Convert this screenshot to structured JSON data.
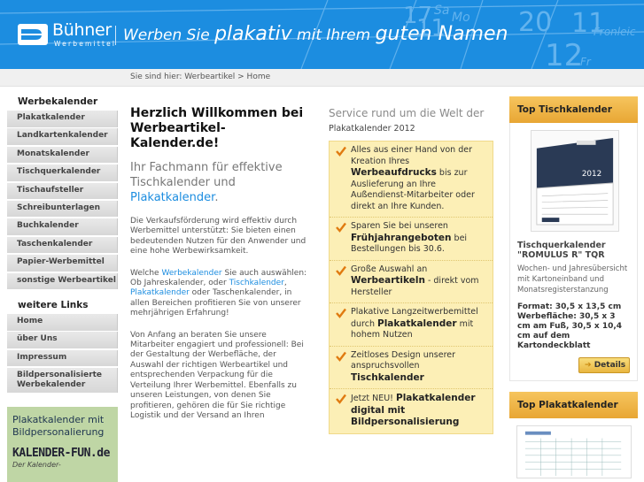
{
  "header": {
    "brand": "Bühner",
    "brand_sub": "Werbemittel",
    "slogan_a": "Werben Sie",
    "slogan_b": "plakativ",
    "slogan_c": "mit Ihrem",
    "slogan_d": "guten Namen",
    "calendar_numbers": [
      "17",
      "Sa",
      "11",
      "Mo",
      "20",
      "11",
      "Fronleic",
      "12",
      "Fr"
    ]
  },
  "breadcrumb": "Sie sind hier: Werbeartikel > Home",
  "sidebar": {
    "heading1": "Werbekalender",
    "items1": [
      "Plakatkalender",
      "Landkartenkalender",
      "Monatskalender",
      "Tischquerkalender",
      "Tischaufsteller",
      "Schreibunterlagen",
      "Buchkalender",
      "Taschenkalender",
      "Papier-Werbemittel",
      "sonstige Werbeartikel"
    ],
    "heading2": "weitere Links",
    "items2": [
      "Home",
      "über Uns",
      "Impressum",
      "Bildpersonalisierte Werbekalender"
    ]
  },
  "promo": {
    "title": "Plakatkalender mit Bildpersonalierung",
    "logo": "KALENDER-FUN.de",
    "sub": "Der Kalender-"
  },
  "main": {
    "title": "Herzlich Willkommen bei Werbeartikel-Kalender.de!",
    "subtitle_a": "Ihr Fachmann für effektive Tischkalender und",
    "subtitle_link": "Plakatkalender",
    "subtitle_end": ".",
    "p1": "Die Verkaufsförderung wird effektiv durch Werbemittel unterstützt: Sie bieten einen bedeutenden Nutzen für den Anwender und eine hohe Werbewirksamkeit.",
    "p2_a": "Welche ",
    "p2_l1": "Werbekalender",
    "p2_b": " Sie auch auswählen: Ob Jahreskalender, oder ",
    "p2_l2": "Tischkalender",
    "p2_c": ", ",
    "p2_l3": "Plakatkalender",
    "p2_d": " oder Taschenkalender, in allen Bereichen profitieren Sie von unserer mehrjährigen Erfahrung!",
    "p3": "Von Anfang an beraten Sie unsere Mitarbeiter engagiert und professionell: Bei der Gestaltung der Werbefläche, der Auswahl der richtigen Werbeartikel und entsprechenden Verpackung für die Verteilung Ihrer Werbemittel. Ebenfalls zu unseren Leistungen, von denen Sie profitieren, gehören die für Sie richtige Logistik und der Versand an Ihren"
  },
  "service": {
    "title": "Service rund um die Welt der",
    "subtitle": "Plakatkalender 2012",
    "items": [
      {
        "a": "Alles aus einer Hand von der Kreation Ihres ",
        "b": "Werbeaufdrucks",
        "c": " bis zur Auslieferung an Ihre Außendienst-Mitarbeiter oder direkt an Ihre Kunden."
      },
      {
        "a": "Sparen Sie bei unseren ",
        "b": "Frühjahrangeboten",
        "c": " bei Bestellungen bis 30.6."
      },
      {
        "a": "Große Auswahl an ",
        "b": "Werbeartikeln",
        "c": " - direkt vom Hersteller"
      },
      {
        "a": "Plakative Langzeitwerbemittel durch ",
        "b": "Plakatkalender",
        "c": " mit hohem Nutzen"
      },
      {
        "a": "Zeitloses Design unserer anspruchsvollen ",
        "b": "Tischkalender",
        "c": ""
      },
      {
        "a": "Jetzt NEU! ",
        "b": "Plakatkalender digital mit Bildpersonalisierung",
        "c": ""
      }
    ]
  },
  "right": {
    "box1_title": "Top Tischkalender",
    "img_year": "2012",
    "prod_name": "Tischquerkalender",
    "prod_model": "\"ROMULUS R\" TQR",
    "prod_desc": "Wochen- und Jahresübersicht mit Kartoneinband und Monatsregisterstanzung",
    "spec1": "Format: 30,5 x 13,5 cm",
    "spec2": "Werbefläche: 30,5 x 3 cm am Fuß, 30,5 x 10,4 cm auf dem Kartondeckblatt",
    "details": "Details",
    "box2_title": "Top Plakatkalender"
  },
  "colors": {
    "header_blue": "#1c8de0",
    "accent_orange": "#e8a634",
    "service_bg": "#fcefb6",
    "check_orange": "#e07a10",
    "promo_green": "#bfd6a5"
  }
}
